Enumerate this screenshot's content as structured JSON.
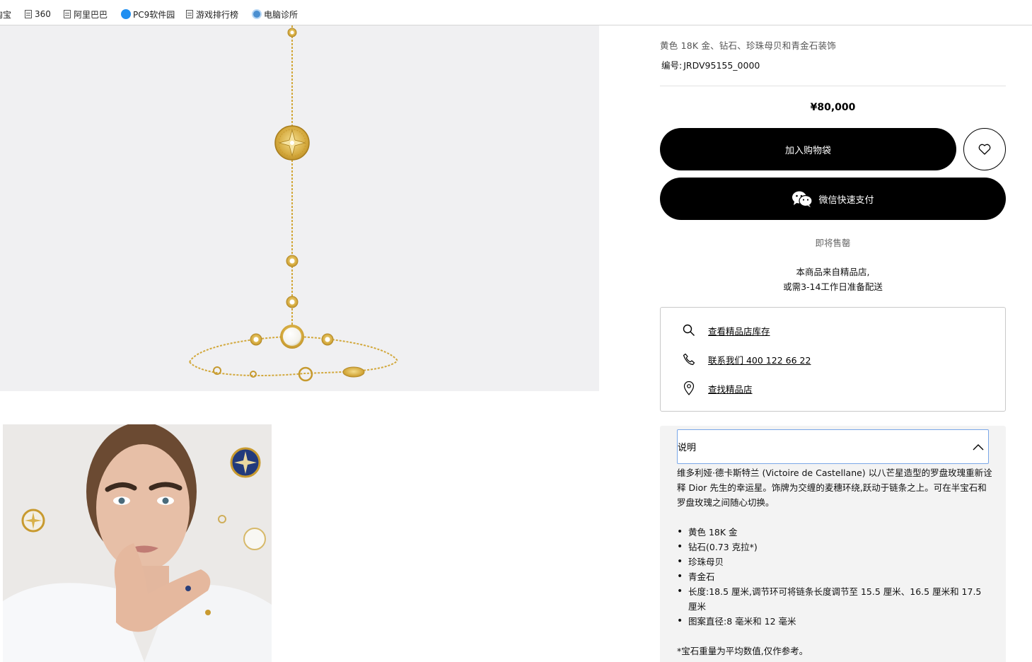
{
  "bookmarks": [
    {
      "label": "淘宝",
      "icon": "none"
    },
    {
      "label": "360",
      "icon": "document-icon"
    },
    {
      "label": "阿里巴巴",
      "icon": "document-icon"
    },
    {
      "label": "PC9软件园",
      "icon": "pc9-logo-icon"
    },
    {
      "label": "游戏排行榜",
      "icon": "document-icon"
    },
    {
      "label": "电脑诊所",
      "icon": "clinic-logo-icon"
    }
  ],
  "product": {
    "subtitle": "黄色 18K 金、钻石、珍珠母贝和青金石装饰",
    "ref_label": "编号:",
    "ref_value": "JRDV95155_0000",
    "price": "¥80,000",
    "add_to_bag": "加入购物袋",
    "wechat_pay": "微信快速支付",
    "availability": "即将售罄",
    "boutique_note_line1": "本商品来自精品店,",
    "boutique_note_line2": "或需3-14工作日准备配送"
  },
  "services": [
    {
      "label": "查看精品店库存",
      "icon": "search-icon"
    },
    {
      "label": "联系我们 400 122 66 22",
      "icon": "phone-icon"
    },
    {
      "label": "查找精品店",
      "icon": "location-pin-icon"
    }
  ],
  "description": {
    "title": "说明",
    "intro": "维多利娅·德卡斯特兰 (Victoire de Castellane) 以八芒星造型的罗盘玫瑰重新诠释 Dior 先生的幸运星。饰牌为交缠的麦穗环绕,跃动于链条之上。可在半宝石和罗盘玫瑰之间随心切换。",
    "bullets": [
      "黄色 18K 金",
      "钻石(0.73 克拉*)",
      "珍珠母贝",
      "青金石",
      "长度:18.5 厘米,调节环可将链条长度调节至 15.5 厘米、16.5 厘米和 17.5 厘米",
      "图案直径:8 毫米和 12 毫米"
    ],
    "footnote": "*宝石重量为平均数值,仅作参考。"
  },
  "colors": {
    "black": "#000000",
    "gold": "#d9b44a",
    "panel": "#f3f3f3",
    "image_bg": "#f0f0f2",
    "focus_border": "#7aa7e8"
  }
}
